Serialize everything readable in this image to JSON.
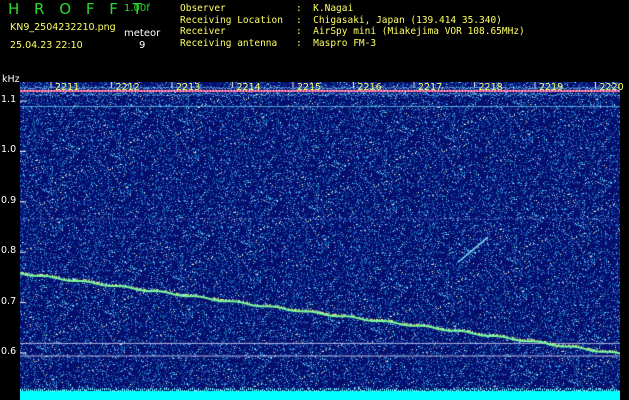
{
  "header": {
    "title": "H R O F F T",
    "version": "1.00f",
    "filename": "KN9_2504232210.png",
    "datetime": "25.04.23 22:10",
    "meteor_label": "meteor",
    "meteor_count": "9"
  },
  "info": [
    {
      "key": "Observer",
      "value": ":  K.Nagai"
    },
    {
      "key": "Receiving Location",
      "value": ":  Chigasaki, Japan (139.414 35.340)"
    },
    {
      "key": "Receiver",
      "value": ":  AirSpy mini (Miakejima VOR 108.65MHz)"
    },
    {
      "key": "Receiving antenna",
      "value": ":  Maspro FM-3"
    }
  ],
  "axis": {
    "y_unit": "kHz",
    "y_ticks": [
      "1.1",
      "1.0",
      "0.9",
      "0.8",
      "0.7",
      "0.6"
    ],
    "x_ticks": [
      "2211",
      "2212",
      "2213",
      "2214",
      "2215",
      "2216",
      "2217",
      "2218",
      "2219",
      "2220"
    ]
  },
  "chart_data": {
    "type": "heatmap",
    "ylabel": "kHz",
    "ylim": [
      0.58,
      1.16
    ],
    "x_ticks": [
      "2211",
      "2212",
      "2213",
      "2214",
      "2215",
      "2216",
      "2217",
      "2218",
      "2219",
      "2220"
    ],
    "y_ticks": [
      1.1,
      1.0,
      0.9,
      0.8,
      0.7,
      0.6
    ],
    "carrier_khz": 1.12,
    "doppler_trace": [
      {
        "x": 0.0,
        "y": 0.76
      },
      {
        "x": 0.25,
        "y": 0.72
      },
      {
        "x": 0.5,
        "y": 0.68
      },
      {
        "x": 0.7,
        "y": 0.65
      },
      {
        "x": 1.0,
        "y": 0.6
      }
    ],
    "meteor_echo": [
      {
        "x": 0.73,
        "y": 0.78
      },
      {
        "x": 0.78,
        "y": 0.83
      }
    ],
    "colors": {
      "background": "#000000",
      "noise_base": "#0a1a6e",
      "carrier": "#ff6fa0",
      "trace": "#7cff9a",
      "baseline": "#00ffff"
    }
  }
}
